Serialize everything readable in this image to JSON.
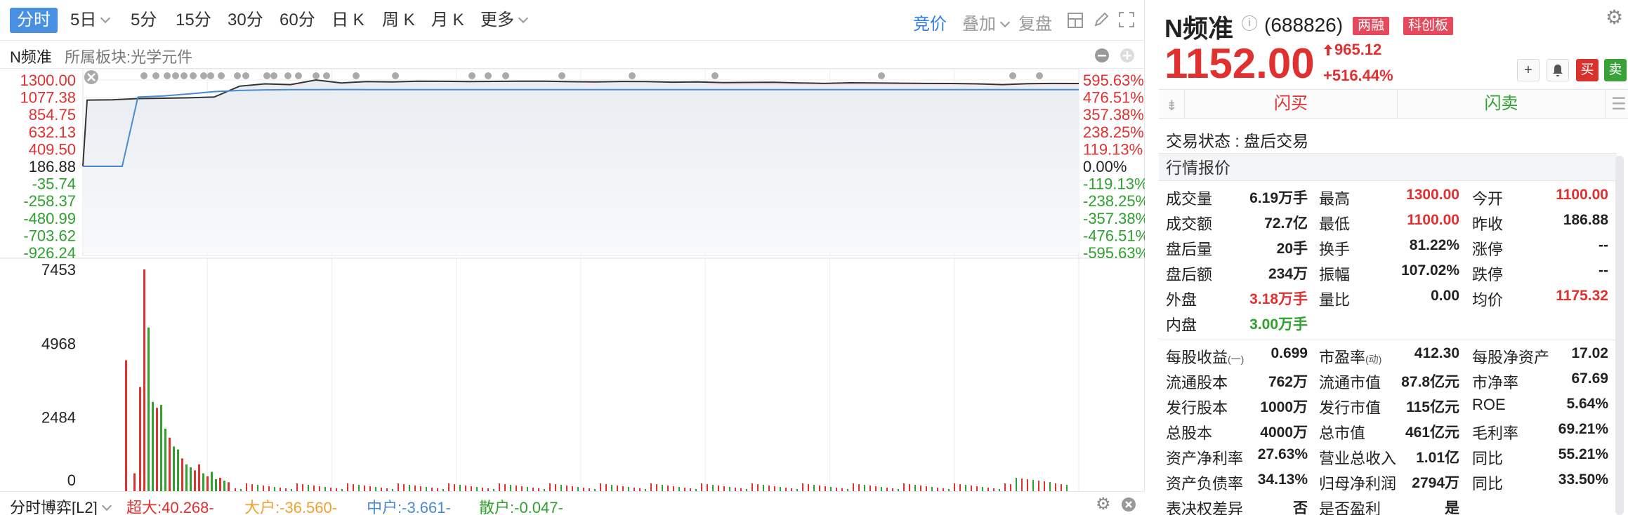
{
  "toolbar": {
    "periods": [
      "分时",
      "5日",
      "5分",
      "15分",
      "30分",
      "60分",
      "日 K",
      "周 K",
      "月 K",
      "更多"
    ],
    "bidding": "竞价",
    "overlay": "叠加",
    "replay": "复盘"
  },
  "subbar": {
    "stock_short": "N频准",
    "sector": "所属板块:光学元件"
  },
  "price_axis": {
    "left": [
      "1300.00",
      "1077.38",
      "854.75",
      "632.13",
      "409.50",
      "186.88",
      "-35.74",
      "-258.37",
      "-480.99",
      "-703.62",
      "-926.24"
    ],
    "right": [
      "595.63%",
      "476.51%",
      "357.38%",
      "238.25%",
      "119.13%",
      "0.00%",
      "-119.13%",
      "-238.25%",
      "-357.38%",
      "-476.51%",
      "-595.63%"
    ]
  },
  "volume_axis": [
    "7453",
    "4968",
    "2484",
    "0"
  ],
  "fund_flow": {
    "label": "分时博弈[L2]",
    "super_large": "超大:40.268-",
    "large": "大户:-36.560-",
    "medium": "中户:-3.661-",
    "retail": "散户:-0.047-"
  },
  "quote": {
    "name": "N频准",
    "code": "(688826)",
    "tags": [
      "两融",
      "科创板"
    ],
    "price": "1152.00",
    "change": "965.12",
    "change_pct": "+516.44%",
    "actions": {
      "add": "+",
      "alert": "bell",
      "buy": "买",
      "sell": "卖"
    },
    "flash_buy": "闪买",
    "flash_sell": "闪卖",
    "status": "交易状态 : 盘后交易",
    "section": "行情报价",
    "rows1": [
      [
        {
          "l": "成交量",
          "v": "6.19万手",
          "c": ""
        },
        {
          "l": "最高",
          "v": "1300.00",
          "c": "red"
        },
        {
          "l": "今开",
          "v": "1100.00",
          "c": "red"
        }
      ],
      [
        {
          "l": "成交额",
          "v": "72.7亿",
          "c": ""
        },
        {
          "l": "最低",
          "v": "1100.00",
          "c": "red"
        },
        {
          "l": "昨收",
          "v": "186.88",
          "c": ""
        }
      ],
      [
        {
          "l": "盘后量",
          "v": "20手",
          "c": ""
        },
        {
          "l": "换手",
          "v": "81.22%",
          "c": ""
        },
        {
          "l": "涨停",
          "v": "--",
          "c": ""
        }
      ],
      [
        {
          "l": "盘后额",
          "v": "234万",
          "c": ""
        },
        {
          "l": "振幅",
          "v": "107.02%",
          "c": ""
        },
        {
          "l": "跌停",
          "v": "--",
          "c": ""
        }
      ],
      [
        {
          "l": "外盘",
          "v": "3.18万手",
          "c": "red"
        },
        {
          "l": "量比",
          "v": "0.00",
          "c": ""
        },
        {
          "l": "均价",
          "v": "1175.32",
          "c": "red"
        }
      ],
      [
        {
          "l": "内盘",
          "v": "3.00万手",
          "c": "green"
        }
      ]
    ],
    "rows2": [
      [
        {
          "l": "每股收益",
          "s": "(一)",
          "v": "0.699"
        },
        {
          "l": "市盈率",
          "s": "(动)",
          "v": "412.30"
        },
        {
          "l": "每股净资产",
          "v": "17.02"
        }
      ],
      [
        {
          "l": "流通股本",
          "v": "762万"
        },
        {
          "l": "流通市值",
          "v": "87.8亿元"
        },
        {
          "l": "市净率",
          "v": "67.69"
        }
      ],
      [
        {
          "l": "发行股本",
          "v": "1000万"
        },
        {
          "l": "发行市值",
          "v": "115亿元"
        },
        {
          "l": "ROE",
          "v": "5.64%"
        }
      ],
      [
        {
          "l": "总股本",
          "v": "4000万"
        },
        {
          "l": "总市值",
          "v": "461亿元"
        },
        {
          "l": "毛利率",
          "v": "69.21%"
        }
      ],
      [
        {
          "l": "资产净利率",
          "v": "27.63%"
        },
        {
          "l": "营业总收入",
          "v": "1.01亿"
        },
        {
          "l": "同比",
          "v": "55.21%"
        }
      ],
      [
        {
          "l": "资产负债率",
          "v": "34.13%"
        },
        {
          "l": "归母净利润",
          "v": "2794万"
        },
        {
          "l": "同比",
          "v": "33.50%"
        }
      ],
      [
        {
          "l": "表决权差异",
          "v": "否"
        },
        {
          "l": "是否盈利",
          "v": "是"
        }
      ]
    ]
  },
  "chart_data": {
    "type": "line",
    "y_axis_left": {
      "min": -926.24,
      "max": 1300.0,
      "ref": 186.88
    },
    "y_axis_right_pct": {
      "min": -595.63,
      "max": 595.63
    },
    "series": [
      {
        "key": "price",
        "color": "#333333",
        "values": [
          186.88,
          1040,
          1045,
          1060,
          1065,
          1070,
          1080,
          1220,
          1250,
          1240,
          1300,
          1262,
          1280,
          1275,
          1285,
          1283,
          1280,
          1282,
          1285,
          1284,
          1278,
          1276,
          1281,
          1279,
          1272,
          1276,
          1266,
          1268,
          1270,
          1262,
          1256,
          1264,
          1262,
          1258,
          1256,
          1255,
          1250,
          1240,
          1252,
          1256,
          1255
        ]
      },
      {
        "key": "avg",
        "color": "#4a8ad4",
        "values": [
          186.88,
          186.88,
          186.88,
          1080,
          1095,
          1120,
          1150,
          1165,
          1172,
          1175,
          1176,
          1177,
          1176,
          1176,
          1176,
          1175,
          1175,
          1175,
          1175,
          1175,
          1175,
          1175,
          1175,
          1175,
          1175,
          1175,
          1175,
          1175,
          1175,
          1175,
          1175,
          1175,
          1175,
          1175,
          1175,
          1175,
          1175,
          1175,
          1175,
          1175,
          1175
        ]
      }
    ],
    "volume": {
      "ylim": [
        0,
        7453
      ],
      "bars": [
        {
          "v": 4400,
          "c": "r"
        },
        {
          "v": 600,
          "c": "r"
        },
        {
          "v": 3500,
          "c": "r"
        },
        {
          "v": 7453,
          "c": "r"
        },
        {
          "v": 5500,
          "c": "g"
        },
        {
          "v": 3000,
          "c": "g"
        },
        {
          "v": 2800,
          "c": "r"
        },
        {
          "v": 2900,
          "c": "g"
        },
        {
          "v": 2100,
          "c": "g"
        },
        {
          "v": 1800,
          "c": "r"
        },
        {
          "v": 1500,
          "c": "g"
        },
        {
          "v": 1400,
          "c": "g"
        },
        {
          "v": 1100,
          "c": "r"
        },
        {
          "v": 900,
          "c": "g"
        },
        {
          "v": 800,
          "c": "g"
        },
        {
          "v": 700,
          "c": "r"
        },
        {
          "v": 900,
          "c": "r"
        },
        {
          "v": 600,
          "c": "g"
        },
        {
          "v": 500,
          "c": "r"
        },
        {
          "v": 650,
          "c": "g"
        },
        {
          "v": 400,
          "c": "g"
        },
        {
          "v": 450,
          "c": "r"
        },
        {
          "v": 350,
          "c": "g"
        },
        {
          "v": 300,
          "c": "r"
        }
      ]
    }
  },
  "colors": {
    "up": "#e03030",
    "down": "#2ea12e",
    "accent": "#4a90e2"
  }
}
